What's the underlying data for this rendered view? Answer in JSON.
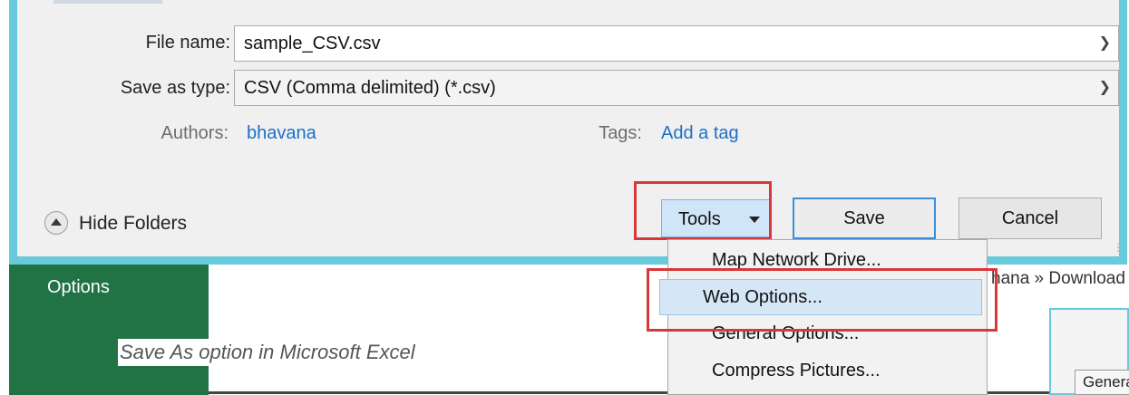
{
  "dialog": {
    "file_name_label": "File name:",
    "file_name_value": "sample_CSV.csv",
    "save_type_label": "Save as type:",
    "save_type_value": "CSV (Comma delimited) (*.csv)",
    "authors_label": "Authors:",
    "authors_value": "bhavana",
    "tags_label": "Tags:",
    "tags_value": "Add a tag",
    "hide_folders_label": "Hide Folders",
    "tools_label": "Tools",
    "save_label": "Save",
    "cancel_label": "Cancel"
  },
  "tools_menu": {
    "items": [
      {
        "label": "Map Network Drive..."
      },
      {
        "label": "Web Options..."
      },
      {
        "label": "General Options..."
      },
      {
        "label": "Compress Pictures..."
      }
    ]
  },
  "background": {
    "options_label": "Options",
    "caption": "Save As option in Microsoft Excel",
    "breadcrumb": "hana » Download",
    "mini_tab_label": "Genera"
  },
  "colors": {
    "dialog_border": "#69cadc",
    "excel_green": "#217346",
    "highlight_red": "#d9383a",
    "link_blue": "#1e6fc7"
  }
}
